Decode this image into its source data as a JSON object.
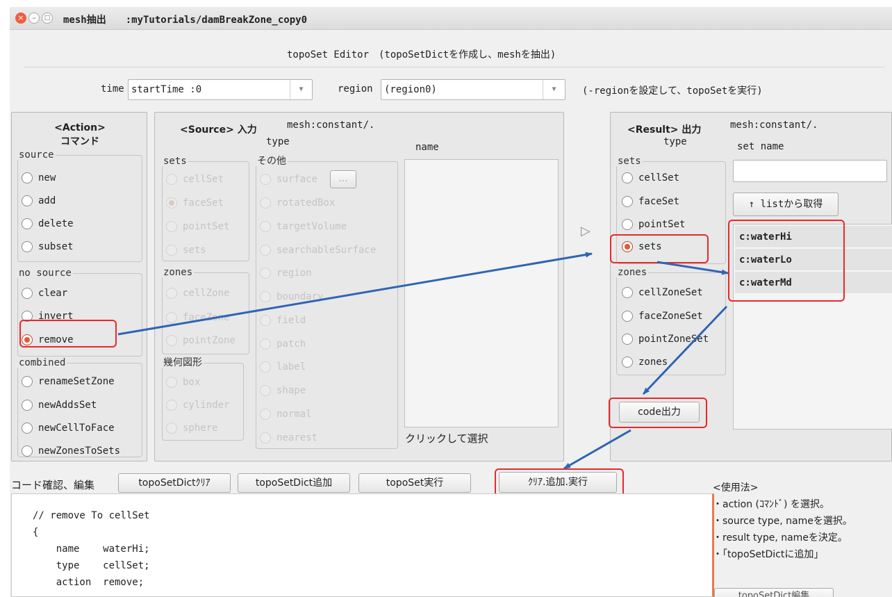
{
  "window": {
    "title": "mesh抽出　　:myTutorials/damBreakZone_copy0",
    "close_glyph": "×",
    "min_glyph": "–",
    "max_glyph": "□"
  },
  "header": {
    "subtitle": "topoSet Editor　(topoSetDictを作成し、meshを抽出)"
  },
  "time_label": "time",
  "time_value": "startTime :0",
  "region_label": "region",
  "region_value": "(region0)",
  "region_hint": "(-regionを設定して、topoSetを実行)",
  "action": {
    "title1": "<Action>",
    "title2": "コマンド",
    "groups": {
      "source": {
        "label": "source",
        "items": [
          "new",
          "add",
          "delete",
          "subset"
        ]
      },
      "nosource": {
        "label": "no source",
        "items": [
          "clear",
          "invert",
          "remove"
        ]
      },
      "combined": {
        "label": "combined",
        "items": [
          "renameSetZone",
          "newAddsSet",
          "newCellToFace",
          "newZonesToSets"
        ]
      }
    },
    "selected": "remove"
  },
  "source": {
    "title": "<Source> 入力",
    "mesh": "mesh:constant/.",
    "type_label": "type",
    "name_label": "name",
    "sets_label": "sets",
    "sets": [
      "cellSet",
      "faceSet",
      "pointSet",
      "sets"
    ],
    "zones_label": "zones",
    "zones": [
      "cellZone",
      "faceZone",
      "pointZone"
    ],
    "geom_label": "幾何図形",
    "geom": [
      "box",
      "cylinder",
      "sphere"
    ],
    "other_label": "その他",
    "other": [
      "surface",
      "rotatedBox",
      "targetVolume",
      "searchableSurface",
      "region",
      "boundary",
      "field",
      "patch",
      "label",
      "shape",
      "normal",
      "nearest"
    ],
    "surface_button": "...",
    "click_hint": "クリックして選択"
  },
  "result": {
    "title": "<Result> 出力",
    "mesh": "mesh:constant/.",
    "type_label": "type",
    "setname_label": "set name",
    "setname_value": "",
    "sets_label": "sets",
    "sets": [
      "cellSet",
      "faceSet",
      "pointSet",
      "sets"
    ],
    "zones_label": "zones",
    "zones": [
      "cellZoneSet",
      "faceZoneSet",
      "pointZoneSet",
      "zones"
    ],
    "selected": "sets",
    "list_button": "↑ listから取得",
    "list": [
      "c:waterHi",
      "c:waterLo",
      "c:waterMd"
    ],
    "code_button": "code出力",
    "play_glyph": "▷"
  },
  "bottom": {
    "code_label": "コード確認、編集",
    "buttons": [
      "topoSetDictｸﾘｱ",
      "topoSetDict追加",
      "topoSet実行",
      "ｸﾘｱ.追加.実行"
    ],
    "code_lines": [
      "// remove To cellSet",
      "{",
      "    name    waterHi;",
      "    type    cellSet;",
      "    action  remove;"
    ],
    "usage_title": "<使用法>",
    "usage_lines": [
      "・action (ｺﾏﾝﾄﾞ) を選択。",
      "・source type, nameを選択。",
      "・result type, nameを決定。",
      "・「topoSetDictに追加」"
    ],
    "edit_button": "topoSetDict編集"
  },
  "colors": {
    "annotation_red": "#e8282b",
    "arrow_blue": "#2f64b4",
    "radio_on": "#e9572f"
  }
}
